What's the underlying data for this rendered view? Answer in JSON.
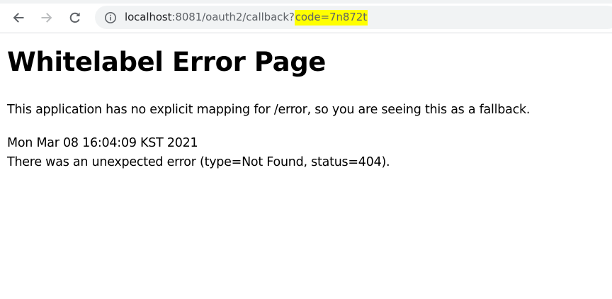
{
  "browser": {
    "back_icon": "arrow-left-icon",
    "forward_icon": "arrow-right-icon",
    "reload_icon": "reload-icon",
    "site_info_icon": "info-icon",
    "url": {
      "host": "localhost",
      "port_path": ":8081/oauth2/callback?",
      "query_highlighted": "code=7n872t"
    },
    "highlight_color": "#ffff00"
  },
  "page": {
    "title": "Whitelabel Error Page",
    "fallback_message": "This application has no explicit mapping for /error, so you are seeing this as a fallback.",
    "timestamp": "Mon Mar 08 16:04:09 KST 2021",
    "error_detail": "There was an unexpected error (type=Not Found, status=404)."
  }
}
